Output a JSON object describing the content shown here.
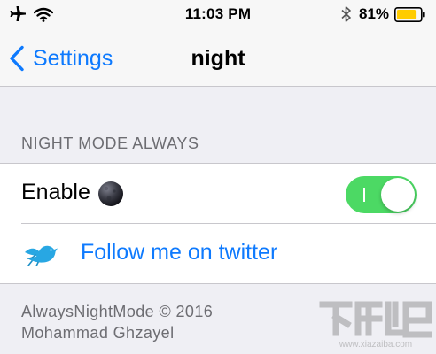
{
  "status_bar": {
    "time": "11:03 PM",
    "battery_percent": "81%",
    "battery_level": 0.81,
    "battery_color": "#ffcc00"
  },
  "nav_bar": {
    "back_label": "Settings",
    "title": "night"
  },
  "section": {
    "header": "NIGHT MODE ALWAYS",
    "enable_label": "Enable",
    "toggle_on": true,
    "toggle_color": "#4cd964",
    "twitter_label": "Follow me on twitter"
  },
  "footer": {
    "line1": "AlwaysNightMode © 2016",
    "line2": "Mohammad Ghzayel"
  },
  "accent_color": "#0e7afe",
  "watermark": {
    "domain": "www.xiazaiba.com"
  }
}
